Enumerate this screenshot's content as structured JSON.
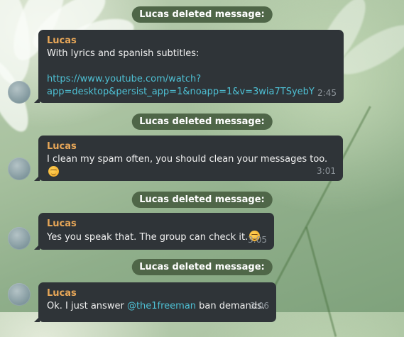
{
  "chat": {
    "service_label": "Lucas deleted message:",
    "messages": [
      {
        "sender": "Lucas",
        "text": "With lyrics and spanish subtitles:",
        "link": "https://www.youtube.com/watch?\napp=desktop&persist_app=1&noapp=1&v=3wia7TSyebY",
        "time": "2:45"
      },
      {
        "sender": "Lucas",
        "text": "I clean my spam often, you should clean your messages too.",
        "emoji": "smirking-face",
        "time": "3:01"
      },
      {
        "sender": "Lucas",
        "text": "Yes you speak that. The group can check it.",
        "emoji": "smirking-face",
        "time": "3:05"
      },
      {
        "sender": "Lucas",
        "text_before": "Ok. I just answer ",
        "mention": "@the1freeman",
        "text_after": " ban demands.",
        "time": "3:06"
      }
    ]
  },
  "colors": {
    "service_bg": "#4f6648",
    "bubble_bg": "#2f3438",
    "sender": "#e8a758",
    "link": "#4ec0d4",
    "time": "#8e959b"
  }
}
